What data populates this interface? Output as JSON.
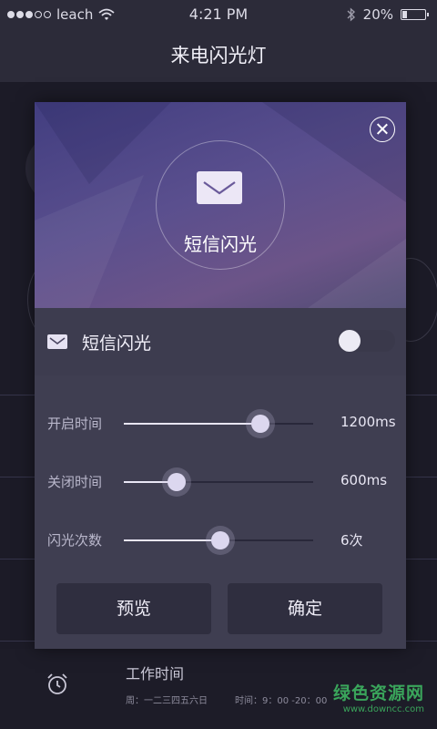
{
  "status_bar": {
    "carrier": "leach",
    "time": "4:21 PM",
    "battery": "20%",
    "battery_level": 0.2
  },
  "header": {
    "title": "来电闪光灯"
  },
  "background": {
    "item_title": "工作时间",
    "item_days": "周：一二三四五六日",
    "item_time": "时间：9：00 -20：00"
  },
  "dialog": {
    "hero_label": "短信闪光",
    "toggle_label": "短信闪光",
    "toggle_on": false,
    "sliders": [
      {
        "label": "开启时间",
        "value": "1200ms",
        "position": 0.72
      },
      {
        "label": "关闭时间",
        "value": "600ms",
        "position": 0.28
      },
      {
        "label": "闪光次数",
        "value": "6次",
        "position": 0.51
      }
    ],
    "preview_label": "预览",
    "confirm_label": "确定"
  },
  "watermark": {
    "main": "绿色资源网",
    "sub": "www.downcc.com"
  },
  "icons": [
    "wifi-icon",
    "bluetooth-icon",
    "battery-icon",
    "close-icon",
    "envelope-icon",
    "alarm-clock-icon"
  ]
}
